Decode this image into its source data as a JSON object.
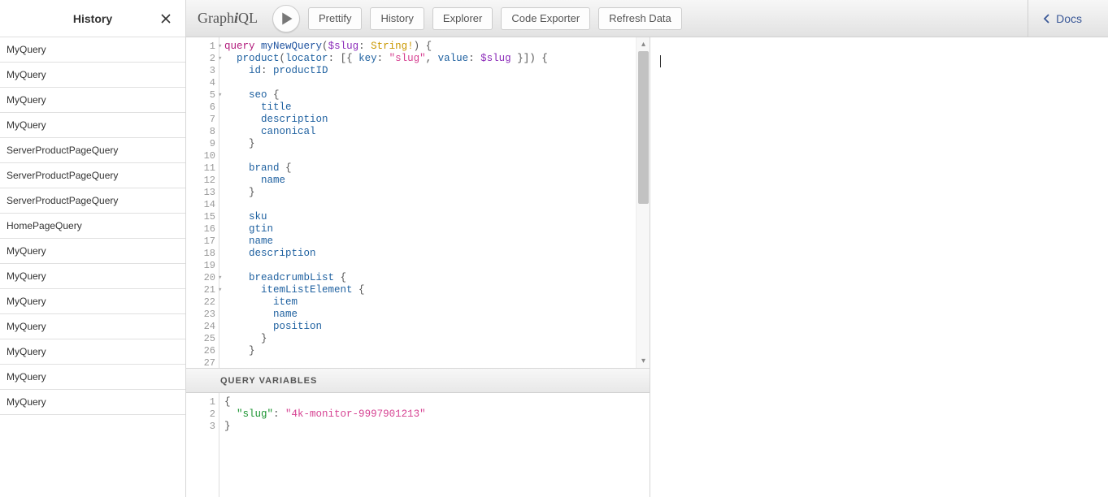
{
  "history": {
    "title": "History",
    "items": [
      "MyQuery",
      "MyQuery",
      "MyQuery",
      "MyQuery",
      "ServerProductPageQuery",
      "ServerProductPageQuery",
      "ServerProductPageQuery",
      "HomePageQuery",
      "MyQuery",
      "MyQuery",
      "MyQuery",
      "MyQuery",
      "MyQuery",
      "MyQuery",
      "MyQuery"
    ]
  },
  "brand": {
    "pre": "Graph",
    "i": "i",
    "post": "QL"
  },
  "toolbar": {
    "prettify": "Prettify",
    "history": "History",
    "explorer": "Explorer",
    "exporter": "Code Exporter",
    "refresh": "Refresh Data"
  },
  "docs": {
    "label": "Docs"
  },
  "variables": {
    "header": "QUERY VARIABLES",
    "lines": [
      [
        {
          "t": "punc",
          "v": "{"
        }
      ],
      [
        {
          "t": "punc",
          "v": "  "
        },
        {
          "t": "varkey",
          "v": "\"slug\""
        },
        {
          "t": "punc",
          "v": ": "
        },
        {
          "t": "str",
          "v": "\"4k-monitor-9997901213\""
        }
      ],
      [
        {
          "t": "punc",
          "v": "}"
        }
      ]
    ],
    "line_numbers": [
      "1",
      "2",
      "3"
    ]
  },
  "query": {
    "line_numbers": [
      "1",
      "2",
      "3",
      "4",
      "5",
      "6",
      "7",
      "8",
      "9",
      "10",
      "11",
      "12",
      "13",
      "14",
      "15",
      "16",
      "17",
      "18",
      "19",
      "20",
      "21",
      "22",
      "23",
      "24",
      "25",
      "26",
      "27"
    ],
    "fold_lines": [
      1,
      2,
      5,
      20,
      21
    ],
    "lines": [
      [
        {
          "t": "kw",
          "v": "query"
        },
        {
          "t": "punc",
          "v": " "
        },
        {
          "t": "name",
          "v": "myNewQuery"
        },
        {
          "t": "punc",
          "v": "("
        },
        {
          "t": "attr",
          "v": "$slug"
        },
        {
          "t": "punc",
          "v": ": "
        },
        {
          "t": "type",
          "v": "String!"
        },
        {
          "t": "punc",
          "v": ") {"
        }
      ],
      [
        {
          "t": "punc",
          "v": "  "
        },
        {
          "t": "prop",
          "v": "product"
        },
        {
          "t": "punc",
          "v": "("
        },
        {
          "t": "prop",
          "v": "locator"
        },
        {
          "t": "punc",
          "v": ": [{ "
        },
        {
          "t": "prop",
          "v": "key"
        },
        {
          "t": "punc",
          "v": ": "
        },
        {
          "t": "str",
          "v": "\"slug\""
        },
        {
          "t": "punc",
          "v": ", "
        },
        {
          "t": "prop",
          "v": "value"
        },
        {
          "t": "punc",
          "v": ": "
        },
        {
          "t": "attr",
          "v": "$slug"
        },
        {
          "t": "punc",
          "v": " }]) {"
        }
      ],
      [
        {
          "t": "punc",
          "v": "    "
        },
        {
          "t": "prop",
          "v": "id"
        },
        {
          "t": "punc",
          "v": ": "
        },
        {
          "t": "prop",
          "v": "productID"
        }
      ],
      [],
      [
        {
          "t": "punc",
          "v": "    "
        },
        {
          "t": "prop",
          "v": "seo"
        },
        {
          "t": "punc",
          "v": " {"
        }
      ],
      [
        {
          "t": "punc",
          "v": "      "
        },
        {
          "t": "prop",
          "v": "title"
        }
      ],
      [
        {
          "t": "punc",
          "v": "      "
        },
        {
          "t": "prop",
          "v": "description"
        }
      ],
      [
        {
          "t": "punc",
          "v": "      "
        },
        {
          "t": "prop",
          "v": "canonical"
        }
      ],
      [
        {
          "t": "punc",
          "v": "    }"
        }
      ],
      [],
      [
        {
          "t": "punc",
          "v": "    "
        },
        {
          "t": "prop",
          "v": "brand"
        },
        {
          "t": "punc",
          "v": " {"
        }
      ],
      [
        {
          "t": "punc",
          "v": "      "
        },
        {
          "t": "prop",
          "v": "name"
        }
      ],
      [
        {
          "t": "punc",
          "v": "    }"
        }
      ],
      [],
      [
        {
          "t": "punc",
          "v": "    "
        },
        {
          "t": "prop",
          "v": "sku"
        }
      ],
      [
        {
          "t": "punc",
          "v": "    "
        },
        {
          "t": "prop",
          "v": "gtin"
        }
      ],
      [
        {
          "t": "punc",
          "v": "    "
        },
        {
          "t": "prop",
          "v": "name"
        }
      ],
      [
        {
          "t": "punc",
          "v": "    "
        },
        {
          "t": "prop",
          "v": "description"
        }
      ],
      [],
      [
        {
          "t": "punc",
          "v": "    "
        },
        {
          "t": "prop",
          "v": "breadcrumbList"
        },
        {
          "t": "punc",
          "v": " {"
        }
      ],
      [
        {
          "t": "punc",
          "v": "      "
        },
        {
          "t": "prop",
          "v": "itemListElement"
        },
        {
          "t": "punc",
          "v": " {"
        }
      ],
      [
        {
          "t": "punc",
          "v": "        "
        },
        {
          "t": "prop",
          "v": "item"
        }
      ],
      [
        {
          "t": "punc",
          "v": "        "
        },
        {
          "t": "prop",
          "v": "name"
        }
      ],
      [
        {
          "t": "punc",
          "v": "        "
        },
        {
          "t": "prop",
          "v": "position"
        }
      ],
      [
        {
          "t": "punc",
          "v": "      }"
        }
      ],
      [
        {
          "t": "punc",
          "v": "    }"
        }
      ],
      []
    ]
  }
}
